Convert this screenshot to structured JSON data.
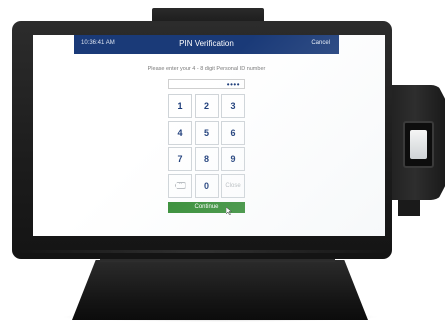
{
  "header": {
    "time": "10:36:41 AM",
    "title": "PIN Verification",
    "cancel_label": "Cancel"
  },
  "instruction": "Please enter your 4 - 8 digit Personal ID number",
  "pin_field": {
    "masked_value": "••••"
  },
  "keypad": {
    "keys": [
      "1",
      "2",
      "3",
      "4",
      "5",
      "6",
      "7",
      "8",
      "9",
      "",
      "0",
      "Close"
    ],
    "backspace_icon": "backspace-icon"
  },
  "continue_label": "Continue",
  "colors": {
    "header_bg": "#1a3a78",
    "digit": "#1a3a78",
    "continue_bg": "#2f8a2f"
  }
}
